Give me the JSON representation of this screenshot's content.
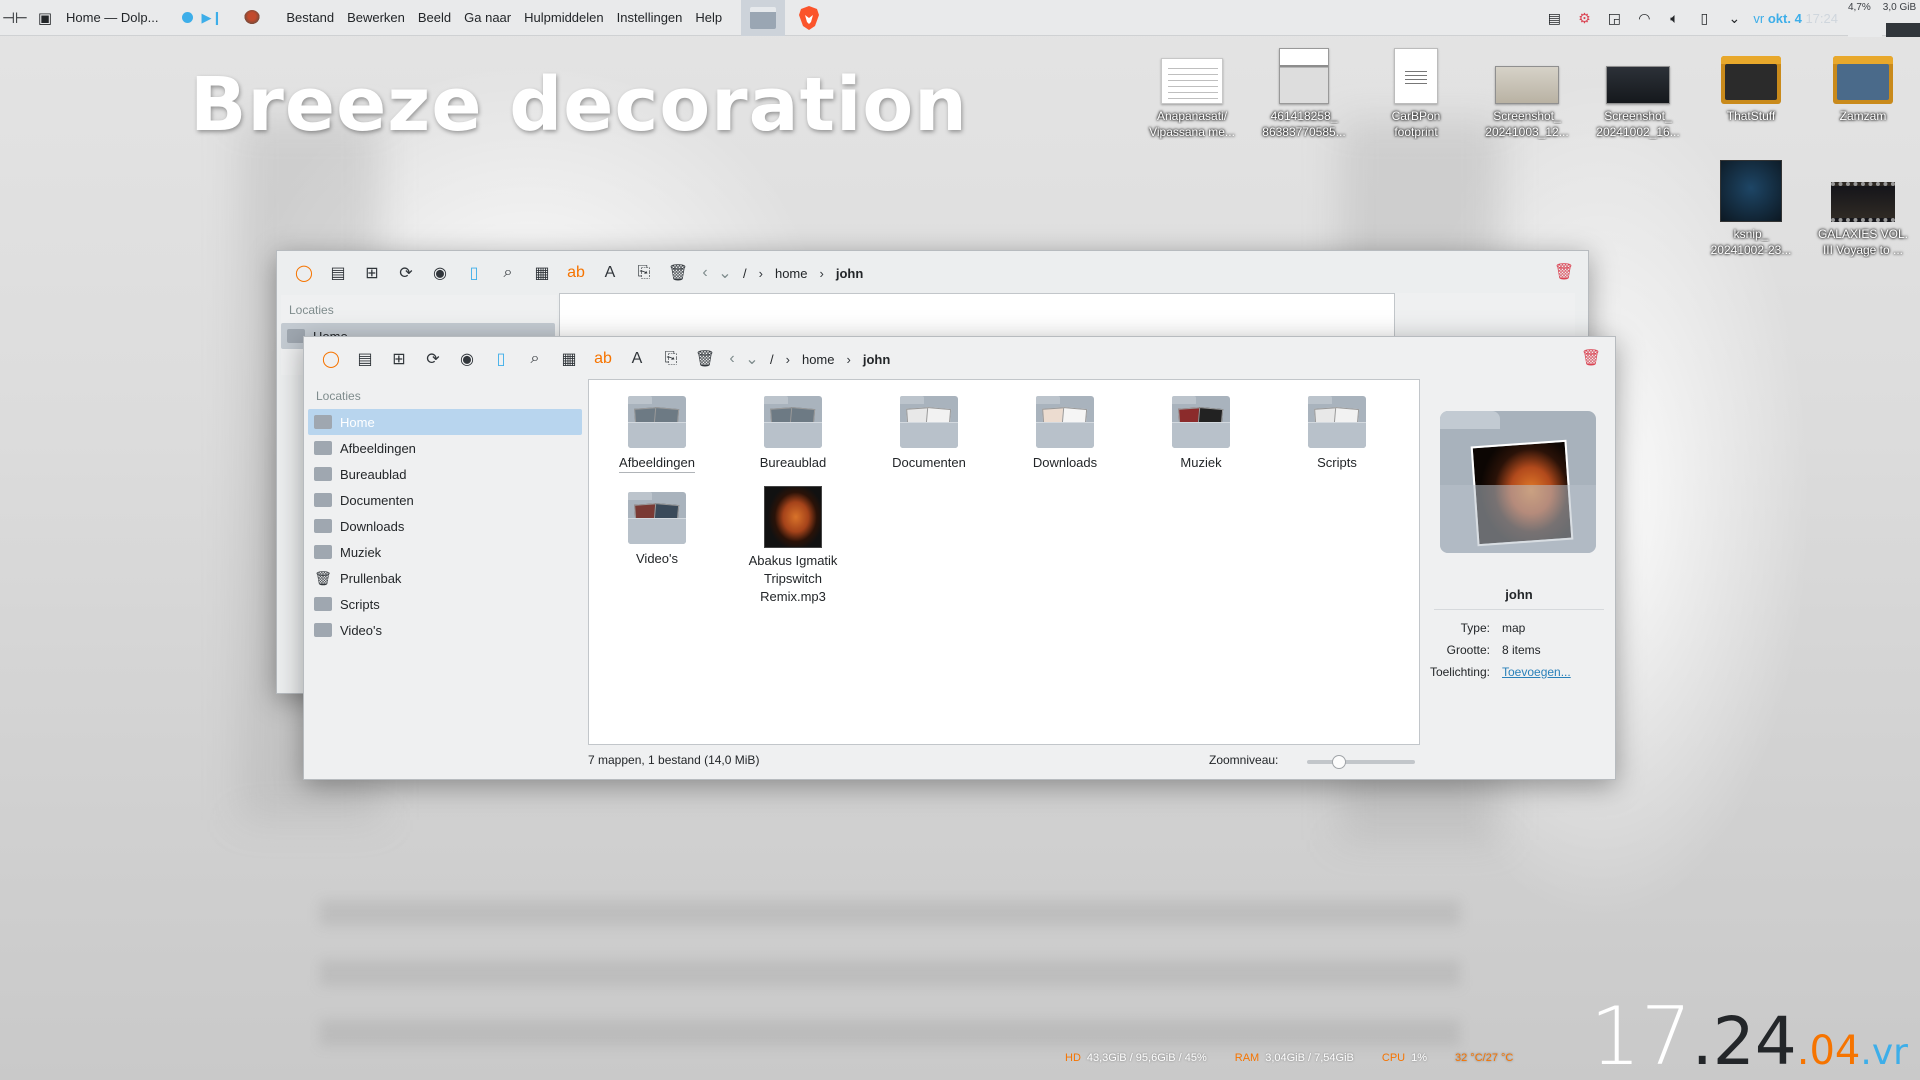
{
  "top_panel": {
    "window_title": "Home — Dolp...",
    "menu": [
      "Bestand",
      "Bewerken",
      "Beeld",
      "Ga naar",
      "Hulpmiddelen",
      "Instellingen",
      "Help"
    ],
    "date_prefix": "vr",
    "date_main": "okt. 4",
    "time": "17:24",
    "cpu_percent": "4,7%",
    "ram": "3,0 GiB"
  },
  "big_title": "Breeze decoration",
  "desktop_icons": [
    {
      "label1": "Anapanasati/",
      "label2": "Vipassana me..."
    },
    {
      "label1": "461418258_",
      "label2": "86383770585..."
    },
    {
      "label1": "CarBPon",
      "label2": "footprint"
    },
    {
      "label1": "Screenshot_",
      "label2": "20241003_12..."
    },
    {
      "label1": "Screenshot_",
      "label2": "20241002_16..."
    },
    {
      "label1": "ThatStuff",
      "label2": ""
    },
    {
      "label1": "Zamzam",
      "label2": ""
    },
    {
      "label1": "ksnip_",
      "label2": "20241002-23..."
    },
    {
      "label1": "GALAXIES VOL.",
      "label2": "III Voyage to ..."
    }
  ],
  "dolphin": {
    "breadcrumbs": [
      "/",
      "home",
      "john"
    ],
    "sidebar_header": "Locaties",
    "places": [
      "Home",
      "Afbeeldingen",
      "Bureaublad",
      "Documenten",
      "Downloads",
      "Muziek",
      "Prullenbak",
      "Scripts",
      "Video's"
    ],
    "files": [
      {
        "label": "Afbeeldingen",
        "kind": "img"
      },
      {
        "label": "Bureaublad",
        "kind": "doc"
      },
      {
        "label": "Documenten",
        "kind": "doc"
      },
      {
        "label": "Downloads",
        "kind": "dl"
      },
      {
        "label": "Muziek",
        "kind": "mus"
      },
      {
        "label": "Scripts",
        "kind": "doc"
      },
      {
        "label": "Video's",
        "kind": "vid"
      },
      {
        "label": "Abakus Igmatik Tripswitch Remix.mp3",
        "kind": "mp3"
      }
    ],
    "status_text": "7 mappen, 1 bestand (14,0 MiB)",
    "zoom_label": "Zoomniveau:",
    "zoom_level": 0.3,
    "info": {
      "name": "john",
      "type_key": "Type:",
      "type_val": "map",
      "size_key": "Grootte:",
      "size_val": "8 items",
      "comment_key": "Toelichting:",
      "comment_val": "Toevoegen..."
    }
  },
  "sysmon": {
    "hd_key": "HD",
    "hd_val": "43,3GiB / 95,6GiB / 45%",
    "ram_key": "RAM",
    "ram_val": "3,04GiB / 7,54GiB",
    "cpu_key": "CPU",
    "cpu_val": "1%",
    "temp_val": "32 °C/27 °C"
  },
  "clock": {
    "hour": "17",
    "minute": "24",
    "day": "04",
    "weekday": "vr"
  },
  "colors": {
    "accent": "#3daee9",
    "orange": "#f67400",
    "danger": "#da4453"
  }
}
